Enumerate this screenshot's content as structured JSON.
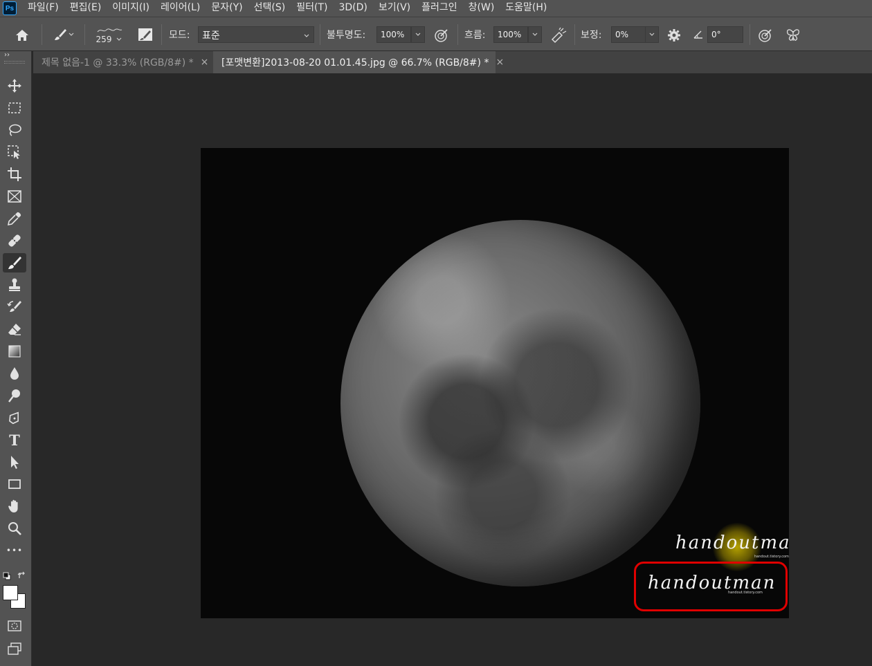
{
  "app": {
    "logo": "Ps"
  },
  "menu": [
    "파일(F)",
    "편집(E)",
    "이미지(I)",
    "레이어(L)",
    "문자(Y)",
    "선택(S)",
    "필터(T)",
    "3D(D)",
    "보기(V)",
    "플러그인",
    "창(W)",
    "도움말(H)"
  ],
  "options": {
    "brush_size": "259",
    "mode_label": "모드:",
    "mode_value": "표준",
    "opacity_label": "불투명도:",
    "opacity_value": "100%",
    "flow_label": "흐름:",
    "flow_value": "100%",
    "smoothing_label": "보정:",
    "smoothing_value": "0%",
    "angle_value": "0°"
  },
  "tabs": [
    {
      "label": "제목 없음-1 @ 33.3% (RGB/8#) *",
      "close": "×",
      "active": false
    },
    {
      "label": "[포맷변환]2013-08-20 01.01.45.jpg @ 66.7% (RGB/8#) *",
      "close": "×",
      "active": true
    }
  ],
  "toolbar": {
    "collapse": "››",
    "tools": [
      "move-tool",
      "marquee-tool",
      "lasso-tool",
      "object-select-tool",
      "crop-tool",
      "frame-tool",
      "eyedropper-tool",
      "healing-brush-tool",
      "brush-tool",
      "clone-stamp-tool",
      "history-brush-tool",
      "eraser-tool",
      "gradient-tool",
      "blur-tool",
      "dodge-tool",
      "pen-tool",
      "type-tool",
      "path-select-tool",
      "rectangle-tool",
      "hand-tool",
      "zoom-tool",
      "more-tools",
      "default-colors",
      "swap-colors",
      "foreground-color",
      "quick-mask",
      "screen-mode"
    ],
    "active_tool": "brush-tool",
    "type_glyph": "T",
    "more_glyph": "•••"
  },
  "canvas": {
    "watermark_upper": "handoutman",
    "watermark_upper_sub": "handout.tistory.com",
    "watermark_lower": "handoutman",
    "watermark_lower_sub": "handout.tistory.com",
    "highlight_color": "#e00000",
    "glow_color": "#b8a000"
  }
}
